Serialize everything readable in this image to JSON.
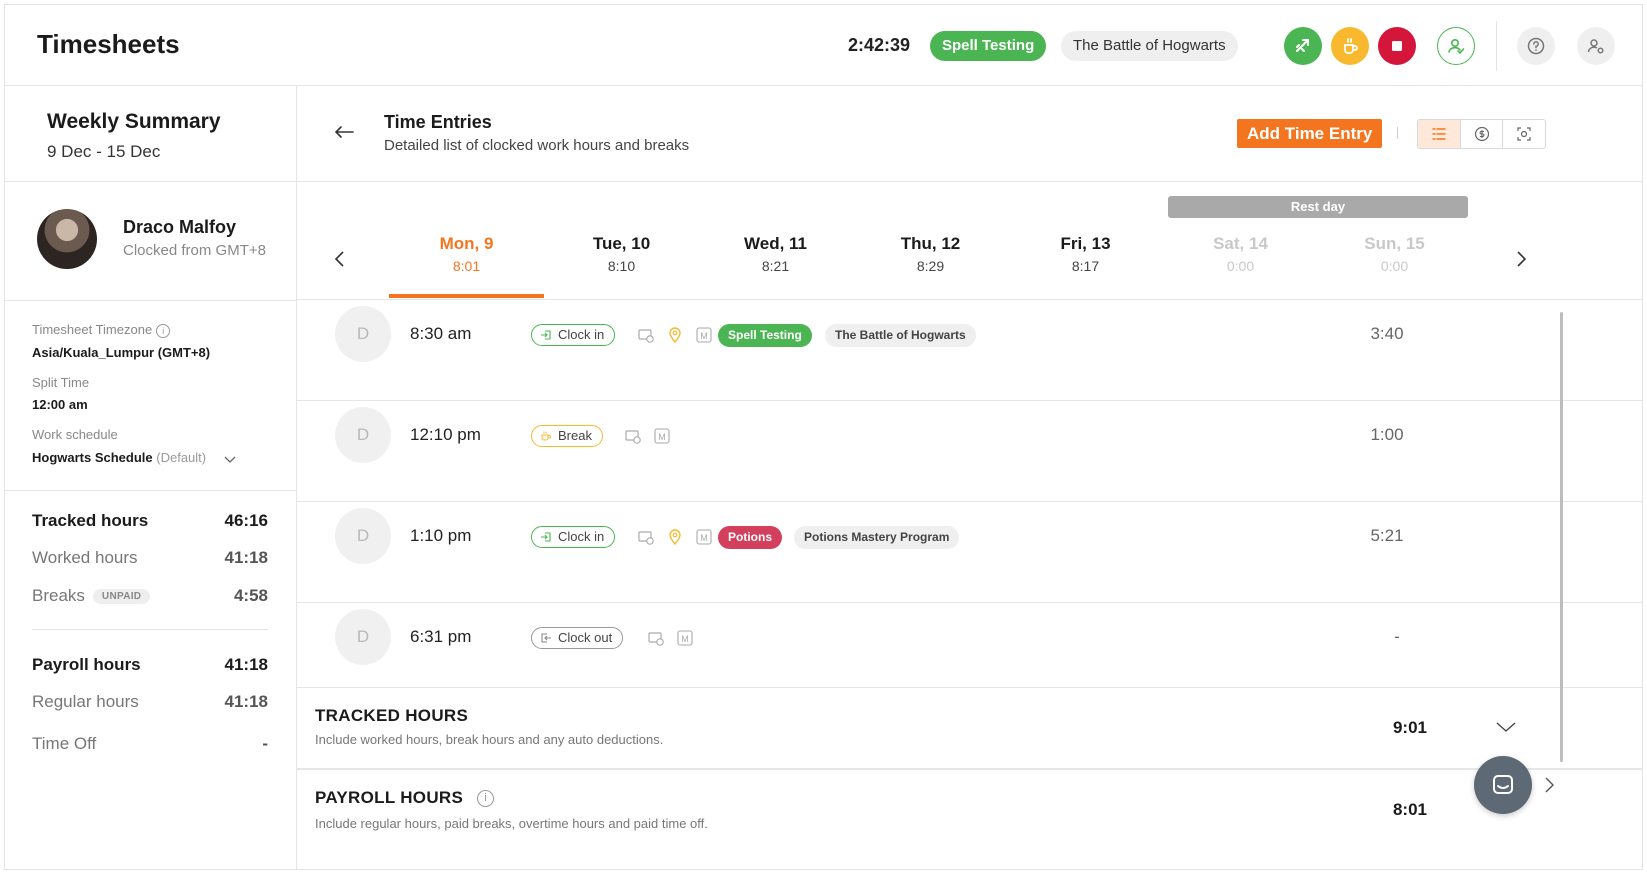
{
  "header": {
    "app_title": "Timesheets",
    "timer": "2:42:39",
    "active_activity": "Spell Testing",
    "active_project": "The Battle of Hogwarts",
    "buttons": [
      "switch-activity",
      "break",
      "stop",
      "people",
      "help",
      "settings"
    ]
  },
  "sidebar": {
    "weekly_title": "Weekly Summary",
    "week_range": "9 Dec - 15 Dec",
    "user_name": "Draco Malfoy",
    "user_sub": "Clocked from GMT+8",
    "timezone_label": "Timesheet Timezone",
    "timezone_value": "Asia/Kuala_Lumpur (GMT+8)",
    "split_label": "Split Time",
    "split_value": "12:00 am",
    "schedule_label": "Work schedule",
    "schedule_value": "Hogwarts Schedule",
    "schedule_default": "(Default)",
    "totals": {
      "tracked_label": "Tracked hours",
      "tracked_value": "46:16",
      "worked_label": "Worked hours",
      "worked_value": "41:18",
      "breaks_label": "Breaks",
      "breaks_badge": "UNPAID",
      "breaks_value": "4:58",
      "payroll_label": "Payroll hours",
      "payroll_value": "41:18",
      "regular_label": "Regular hours",
      "regular_value": "41:18",
      "timeoff_label": "Time Off",
      "timeoff_value": "-"
    }
  },
  "main": {
    "title": "Time Entries",
    "subtitle": "Detailed list of clocked work hours and breaks",
    "add_button": "Add Time Entry",
    "rest_day_label": "Rest day",
    "days": [
      {
        "name": "Mon, 9",
        "time": "8:01",
        "state": "active"
      },
      {
        "name": "Tue, 10",
        "time": "8:10",
        "state": "normal"
      },
      {
        "name": "Wed, 11",
        "time": "8:21",
        "state": "normal"
      },
      {
        "name": "Thu, 12",
        "time": "8:29",
        "state": "normal"
      },
      {
        "name": "Fri, 13",
        "time": "8:17",
        "state": "normal"
      },
      {
        "name": "Sat, 14",
        "time": "0:00",
        "state": "muted"
      },
      {
        "name": "Sun, 15",
        "time": "0:00",
        "state": "muted"
      }
    ],
    "entries": [
      {
        "avatar": "D",
        "time": "8:30 am",
        "type": "Clock in",
        "activity": "Spell Testing",
        "project": "The Battle of Hogwarts",
        "duration": "3:40"
      },
      {
        "avatar": "D",
        "time": "12:10 pm",
        "type": "Break",
        "duration": "1:00"
      },
      {
        "avatar": "D",
        "time": "1:10 pm",
        "type": "Clock in",
        "activity": "Potions",
        "project": "Potions Mastery Program",
        "duration": "5:21"
      },
      {
        "avatar": "D",
        "time": "6:31 pm",
        "type": "Clock out",
        "duration": "-"
      }
    ],
    "tracked_section": {
      "title": "TRACKED HOURS",
      "desc": "Include worked hours, break hours and any auto deductions.",
      "value": "9:01"
    },
    "payroll_section": {
      "title": "PAYROLL HOURS",
      "desc": "Include regular hours, paid breaks, overtime hours and paid time off.",
      "value": "8:01"
    }
  },
  "colors": {
    "accent": "#f4751f",
    "green": "#4bb553",
    "yellow": "#f8b92e",
    "red": "#d3163a",
    "potions": "#d3405d"
  }
}
